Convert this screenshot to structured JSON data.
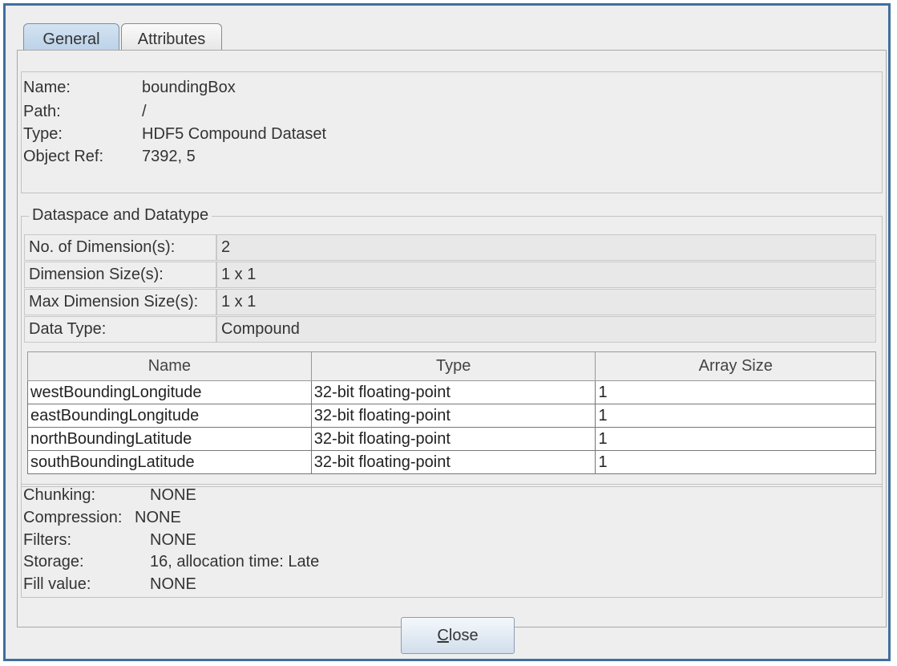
{
  "tabs": [
    {
      "label": "General",
      "active": true
    },
    {
      "label": "Attributes",
      "active": false
    }
  ],
  "general": {
    "name_label": "Name:",
    "name_value": "boundingBox",
    "path_label": "Path:",
    "path_value": "/",
    "type_label": "Type:",
    "type_value": "HDF5 Compound Dataset",
    "objref_label": "Object Ref:",
    "objref_value": "7392, 5"
  },
  "dataspace": {
    "title": "Dataspace and Datatype",
    "rows": [
      {
        "label": "No. of Dimension(s):",
        "value": "2"
      },
      {
        "label": "Dimension Size(s):",
        "value": "1 x 1"
      },
      {
        "label": "Max Dimension Size(s):",
        "value": "1 x 1"
      },
      {
        "label": "Data Type:",
        "value": "Compound"
      }
    ]
  },
  "fields_table": {
    "headers": [
      "Name",
      "Type",
      "Array Size"
    ],
    "rows": [
      [
        "westBoundingLongitude",
        "32-bit floating-point",
        "1"
      ],
      [
        "eastBoundingLongitude",
        "32-bit floating-point",
        "1"
      ],
      [
        "northBoundingLatitude",
        "32-bit floating-point",
        "1"
      ],
      [
        "southBoundingLatitude",
        "32-bit floating-point",
        "1"
      ]
    ]
  },
  "storage": {
    "chunking_label": "Chunking:",
    "chunking_value": "NONE",
    "compression_label": "Compression:",
    "compression_value": "NONE",
    "filters_label": "Filters:",
    "filters_value": "NONE",
    "storage_label": "Storage:",
    "storage_value": "16, allocation time: Late",
    "fill_label": "Fill value:",
    "fill_value": "NONE"
  },
  "buttons": {
    "close_first": "C",
    "close_rest": "lose"
  },
  "colors": {
    "window_border": "#3f6f9f",
    "active_tab": "#c6daee",
    "background": "#eeeeee"
  }
}
